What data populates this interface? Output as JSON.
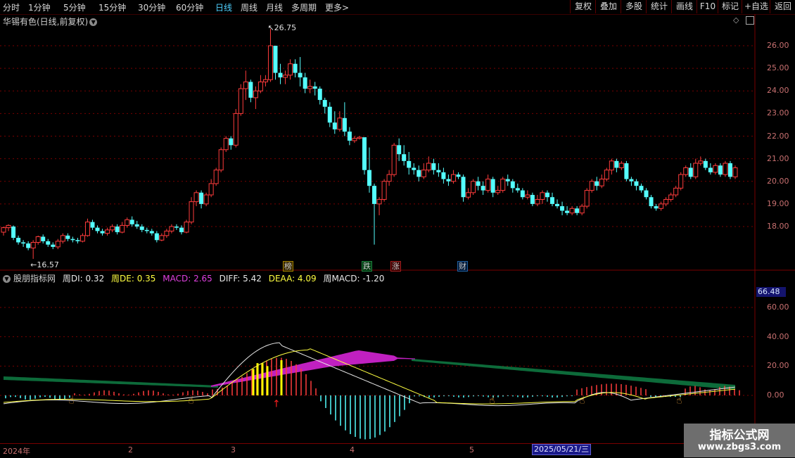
{
  "toolbar": {
    "periods": [
      "分时",
      "1分钟",
      "5分钟",
      "15分钟",
      "30分钟",
      "60分钟",
      "日线",
      "周线",
      "月线",
      "多周期",
      "更多"
    ],
    "active_period": "日线",
    "more_arrow": ">",
    "tools": [
      "复权",
      "叠加",
      "多股",
      "统计",
      "画线",
      "F10",
      "标记",
      "+自选",
      "返回"
    ]
  },
  "main_chart": {
    "title": "华锡有色(日线,前复权)",
    "high_label": "26.75",
    "low_label": "16.57",
    "price_ticks": [
      "26.00",
      "25.00",
      "24.00",
      "23.00",
      "22.00",
      "21.00",
      "20.00",
      "19.00",
      "18.00"
    ],
    "event_marks": [
      {
        "text": "榜",
        "color": "#e8c000"
      },
      {
        "text": "跌",
        "color": "#20c040"
      },
      {
        "text": "涨",
        "color": "#e03030"
      },
      {
        "text": "财",
        "color": "#4fa0ff"
      }
    ]
  },
  "indicator": {
    "name": "股朋指标网",
    "values": [
      {
        "text": "周DI: 0.32",
        "color": "#e8e8e8"
      },
      {
        "text": "周DE: 0.35",
        "color": "#ffff40"
      },
      {
        "text": "MACD: 2.65",
        "color": "#e040e0"
      },
      {
        "text": "DIFF: 5.42",
        "color": "#e8e8e8"
      },
      {
        "text": "DEAA: 4.09",
        "color": "#ffff40"
      },
      {
        "text": "周MACD: -1.20",
        "color": "#e8e8e8"
      }
    ],
    "current_value": "66.48",
    "ticks": [
      "60.00",
      "40.00",
      "20.00",
      "0.00"
    ]
  },
  "date_axis": {
    "labels": [
      "2024年",
      "2",
      "3",
      "4",
      "5"
    ],
    "current_date": "2025/05/21/三"
  },
  "watermark": {
    "title": "指标公式网",
    "url": "www.zbgs3.com"
  },
  "colors": {
    "up": "#ff3c3c",
    "down": "#54ffff",
    "grid": "#7a0000",
    "axis": "#c87070",
    "bar_red": "#ff3c3c",
    "bar_cyan": "#54ffff",
    "signal_yellow": "#ffff00",
    "purple_band": "#c020c0",
    "green_band": "#0d6b3a"
  },
  "chart_data": {
    "type": "candlestick",
    "y_range": [
      16.5,
      26.8
    ],
    "candles": [
      [
        17.75,
        17.95,
        17.6,
        18.0
      ],
      [
        17.95,
        18.05,
        17.8,
        18.1
      ],
      [
        18.0,
        17.5,
        17.4,
        18.05
      ],
      [
        17.5,
        17.3,
        17.2,
        17.6
      ],
      [
        17.3,
        17.25,
        17.1,
        17.4
      ],
      [
        17.25,
        17.05,
        16.95,
        17.35
      ],
      [
        17.05,
        17.3,
        16.57,
        17.4
      ],
      [
        17.3,
        17.55,
        17.2,
        17.6
      ],
      [
        17.55,
        17.35,
        17.25,
        17.65
      ],
      [
        17.35,
        17.2,
        17.1,
        17.45
      ],
      [
        17.2,
        17.1,
        17.0,
        17.3
      ],
      [
        17.1,
        17.35,
        17.0,
        17.45
      ],
      [
        17.35,
        17.6,
        17.25,
        17.7
      ],
      [
        17.6,
        17.45,
        17.35,
        17.7
      ],
      [
        17.45,
        17.4,
        17.3,
        17.55
      ],
      [
        17.4,
        17.35,
        17.25,
        17.5
      ],
      [
        17.35,
        17.6,
        17.3,
        17.7
      ],
      [
        17.6,
        18.2,
        17.55,
        18.35
      ],
      [
        18.2,
        17.95,
        17.85,
        18.3
      ],
      [
        17.95,
        17.8,
        17.7,
        18.05
      ],
      [
        17.8,
        17.7,
        17.6,
        17.9
      ],
      [
        17.7,
        17.85,
        17.6,
        17.95
      ],
      [
        17.85,
        18.0,
        17.75,
        18.1
      ],
      [
        18.0,
        17.75,
        17.65,
        18.1
      ],
      [
        17.75,
        18.05,
        17.7,
        18.2
      ],
      [
        18.05,
        18.3,
        17.95,
        18.4
      ],
      [
        18.3,
        18.1,
        18.0,
        18.45
      ],
      [
        18.1,
        18.0,
        17.9,
        18.25
      ],
      [
        18.0,
        17.85,
        17.75,
        18.1
      ],
      [
        17.85,
        17.8,
        17.7,
        17.95
      ],
      [
        17.8,
        17.7,
        17.6,
        17.9
      ],
      [
        17.7,
        17.4,
        17.3,
        17.8
      ],
      [
        17.4,
        17.6,
        17.35,
        17.7
      ],
      [
        17.6,
        17.8,
        17.5,
        17.9
      ],
      [
        17.8,
        18.0,
        17.7,
        18.1
      ],
      [
        18.0,
        17.95,
        17.85,
        18.1
      ],
      [
        17.95,
        17.75,
        17.65,
        18.05
      ],
      [
        17.75,
        18.2,
        17.7,
        18.3
      ],
      [
        18.2,
        19.1,
        18.1,
        19.3
      ],
      [
        19.1,
        19.5,
        18.9,
        19.6
      ],
      [
        19.5,
        19.0,
        18.8,
        19.6
      ],
      [
        19.0,
        19.4,
        18.9,
        19.5
      ],
      [
        19.4,
        19.9,
        19.3,
        20.1
      ],
      [
        19.9,
        20.5,
        19.8,
        20.6
      ],
      [
        20.5,
        21.4,
        20.4,
        21.5
      ],
      [
        21.4,
        21.9,
        21.3,
        22.0
      ],
      [
        21.9,
        21.6,
        21.4,
        22.0
      ],
      [
        21.6,
        23.0,
        21.5,
        23.2
      ],
      [
        23.0,
        24.1,
        22.9,
        24.3
      ],
      [
        24.1,
        24.4,
        23.6,
        24.9
      ],
      [
        24.4,
        23.7,
        23.5,
        24.5
      ],
      [
        23.7,
        24.0,
        23.2,
        24.2
      ],
      [
        24.0,
        24.4,
        23.9,
        24.7
      ],
      [
        24.4,
        24.5,
        24.2,
        24.7
      ],
      [
        24.5,
        26.0,
        24.4,
        26.75
      ],
      [
        26.0,
        24.8,
        24.5,
        26.0
      ],
      [
        24.8,
        24.6,
        24.3,
        25.2
      ],
      [
        24.6,
        24.7,
        24.3,
        24.9
      ],
      [
        24.7,
        25.2,
        24.5,
        25.4
      ],
      [
        25.2,
        24.8,
        24.6,
        25.4
      ],
      [
        24.8,
        24.6,
        24.2,
        25.5
      ],
      [
        24.6,
        24.1,
        23.9,
        24.8
      ],
      [
        24.1,
        24.2,
        23.9,
        24.5
      ],
      [
        24.2,
        24.1,
        23.8,
        24.4
      ],
      [
        24.1,
        23.6,
        23.4,
        24.2
      ],
      [
        23.6,
        23.3,
        23.0,
        23.7
      ],
      [
        23.3,
        22.6,
        22.4,
        23.5
      ],
      [
        22.6,
        22.3,
        22.1,
        23.1
      ],
      [
        22.3,
        22.8,
        22.2,
        23.1
      ],
      [
        22.8,
        22.2,
        22.0,
        23.5
      ],
      [
        22.2,
        21.8,
        21.6,
        22.4
      ],
      [
        21.8,
        21.9,
        21.7,
        22.0
      ],
      [
        21.9,
        21.95,
        21.85,
        22.0
      ],
      [
        21.95,
        20.5,
        20.3,
        20.6
      ],
      [
        20.5,
        19.8,
        19.5,
        21.5
      ],
      [
        19.8,
        19.0,
        17.2,
        19.9
      ],
      [
        19.0,
        19.2,
        18.5,
        19.3
      ],
      [
        19.2,
        20.0,
        19.1,
        20.1
      ],
      [
        20.0,
        20.3,
        19.8,
        20.5
      ],
      [
        20.3,
        21.6,
        20.2,
        21.7
      ],
      [
        21.6,
        21.2,
        20.9,
        21.9
      ],
      [
        21.2,
        20.9,
        20.7,
        21.6
      ],
      [
        20.9,
        20.6,
        20.3,
        21.3
      ],
      [
        20.6,
        20.5,
        20.3,
        20.8
      ],
      [
        20.5,
        20.2,
        20.0,
        20.7
      ],
      [
        20.2,
        20.5,
        20.1,
        20.8
      ],
      [
        20.5,
        20.8,
        20.4,
        21.1
      ],
      [
        20.8,
        20.5,
        20.3,
        21.0
      ],
      [
        20.5,
        20.4,
        20.2,
        20.8
      ],
      [
        20.4,
        20.1,
        19.9,
        20.6
      ],
      [
        20.1,
        20.0,
        19.8,
        20.3
      ],
      [
        20.0,
        20.3,
        19.9,
        20.5
      ],
      [
        20.3,
        20.2,
        20.1,
        20.4
      ],
      [
        20.2,
        19.3,
        19.1,
        20.3
      ],
      [
        19.3,
        19.5,
        19.2,
        19.7
      ],
      [
        19.5,
        20.0,
        19.4,
        20.1
      ],
      [
        20.0,
        19.8,
        19.6,
        20.2
      ],
      [
        19.8,
        19.6,
        19.4,
        20.0
      ],
      [
        19.6,
        20.1,
        19.5,
        20.3
      ],
      [
        20.1,
        19.5,
        19.3,
        20.2
      ],
      [
        19.5,
        19.6,
        19.4,
        19.8
      ],
      [
        19.6,
        20.1,
        19.5,
        20.2
      ],
      [
        20.1,
        20.0,
        19.8,
        20.3
      ],
      [
        20.0,
        19.7,
        19.5,
        20.1
      ],
      [
        19.7,
        19.6,
        19.5,
        19.9
      ],
      [
        19.6,
        19.3,
        19.2,
        19.7
      ],
      [
        19.3,
        19.4,
        19.2,
        19.6
      ],
      [
        19.4,
        19.0,
        18.9,
        19.5
      ],
      [
        19.0,
        19.2,
        18.9,
        19.4
      ],
      [
        19.2,
        19.5,
        19.0,
        19.6
      ],
      [
        19.5,
        19.3,
        19.1,
        19.6
      ],
      [
        19.3,
        19.0,
        18.9,
        19.5
      ],
      [
        19.0,
        18.9,
        18.8,
        19.2
      ],
      [
        18.9,
        18.7,
        18.5,
        19.1
      ],
      [
        18.7,
        18.6,
        18.5,
        18.9
      ],
      [
        18.6,
        18.8,
        18.5,
        18.9
      ],
      [
        18.8,
        18.6,
        18.5,
        18.9
      ],
      [
        18.6,
        18.9,
        18.5,
        19.0
      ],
      [
        18.9,
        19.6,
        18.8,
        19.7
      ],
      [
        19.6,
        20.0,
        19.5,
        20.1
      ],
      [
        20.0,
        19.8,
        19.6,
        20.2
      ],
      [
        19.8,
        20.1,
        19.7,
        20.3
      ],
      [
        20.1,
        20.5,
        20.0,
        20.6
      ],
      [
        20.5,
        20.9,
        20.3,
        21.0
      ],
      [
        20.9,
        20.6,
        20.4,
        21.0
      ],
      [
        20.6,
        20.8,
        20.5,
        20.9
      ],
      [
        20.8,
        20.1,
        20.0,
        20.9
      ],
      [
        20.1,
        20.0,
        19.8,
        20.2
      ],
      [
        20.0,
        19.8,
        19.6,
        20.1
      ],
      [
        19.8,
        19.6,
        19.5,
        19.9
      ],
      [
        19.6,
        19.3,
        19.2,
        19.7
      ],
      [
        19.3,
        18.9,
        18.8,
        19.4
      ],
      [
        18.9,
        18.8,
        18.7,
        19.0
      ],
      [
        18.8,
        19.0,
        18.7,
        19.1
      ],
      [
        19.0,
        19.2,
        18.9,
        19.3
      ],
      [
        19.2,
        19.4,
        19.1,
        19.5
      ],
      [
        19.4,
        19.7,
        19.3,
        19.8
      ],
      [
        19.7,
        20.3,
        19.6,
        20.4
      ],
      [
        20.3,
        20.6,
        20.2,
        20.7
      ],
      [
        20.6,
        20.2,
        20.1,
        20.8
      ],
      [
        20.2,
        20.8,
        20.1,
        21.0
      ],
      [
        20.8,
        20.9,
        20.7,
        21.1
      ],
      [
        20.9,
        20.6,
        20.5,
        21.0
      ],
      [
        20.6,
        20.4,
        20.3,
        20.8
      ],
      [
        20.4,
        20.7,
        20.3,
        20.8
      ],
      [
        20.7,
        20.3,
        20.2,
        20.8
      ],
      [
        20.3,
        20.8,
        20.2,
        20.9
      ],
      [
        20.8,
        20.2,
        20.1,
        20.9
      ],
      [
        20.2,
        20.6,
        20.1,
        20.7
      ]
    ]
  }
}
